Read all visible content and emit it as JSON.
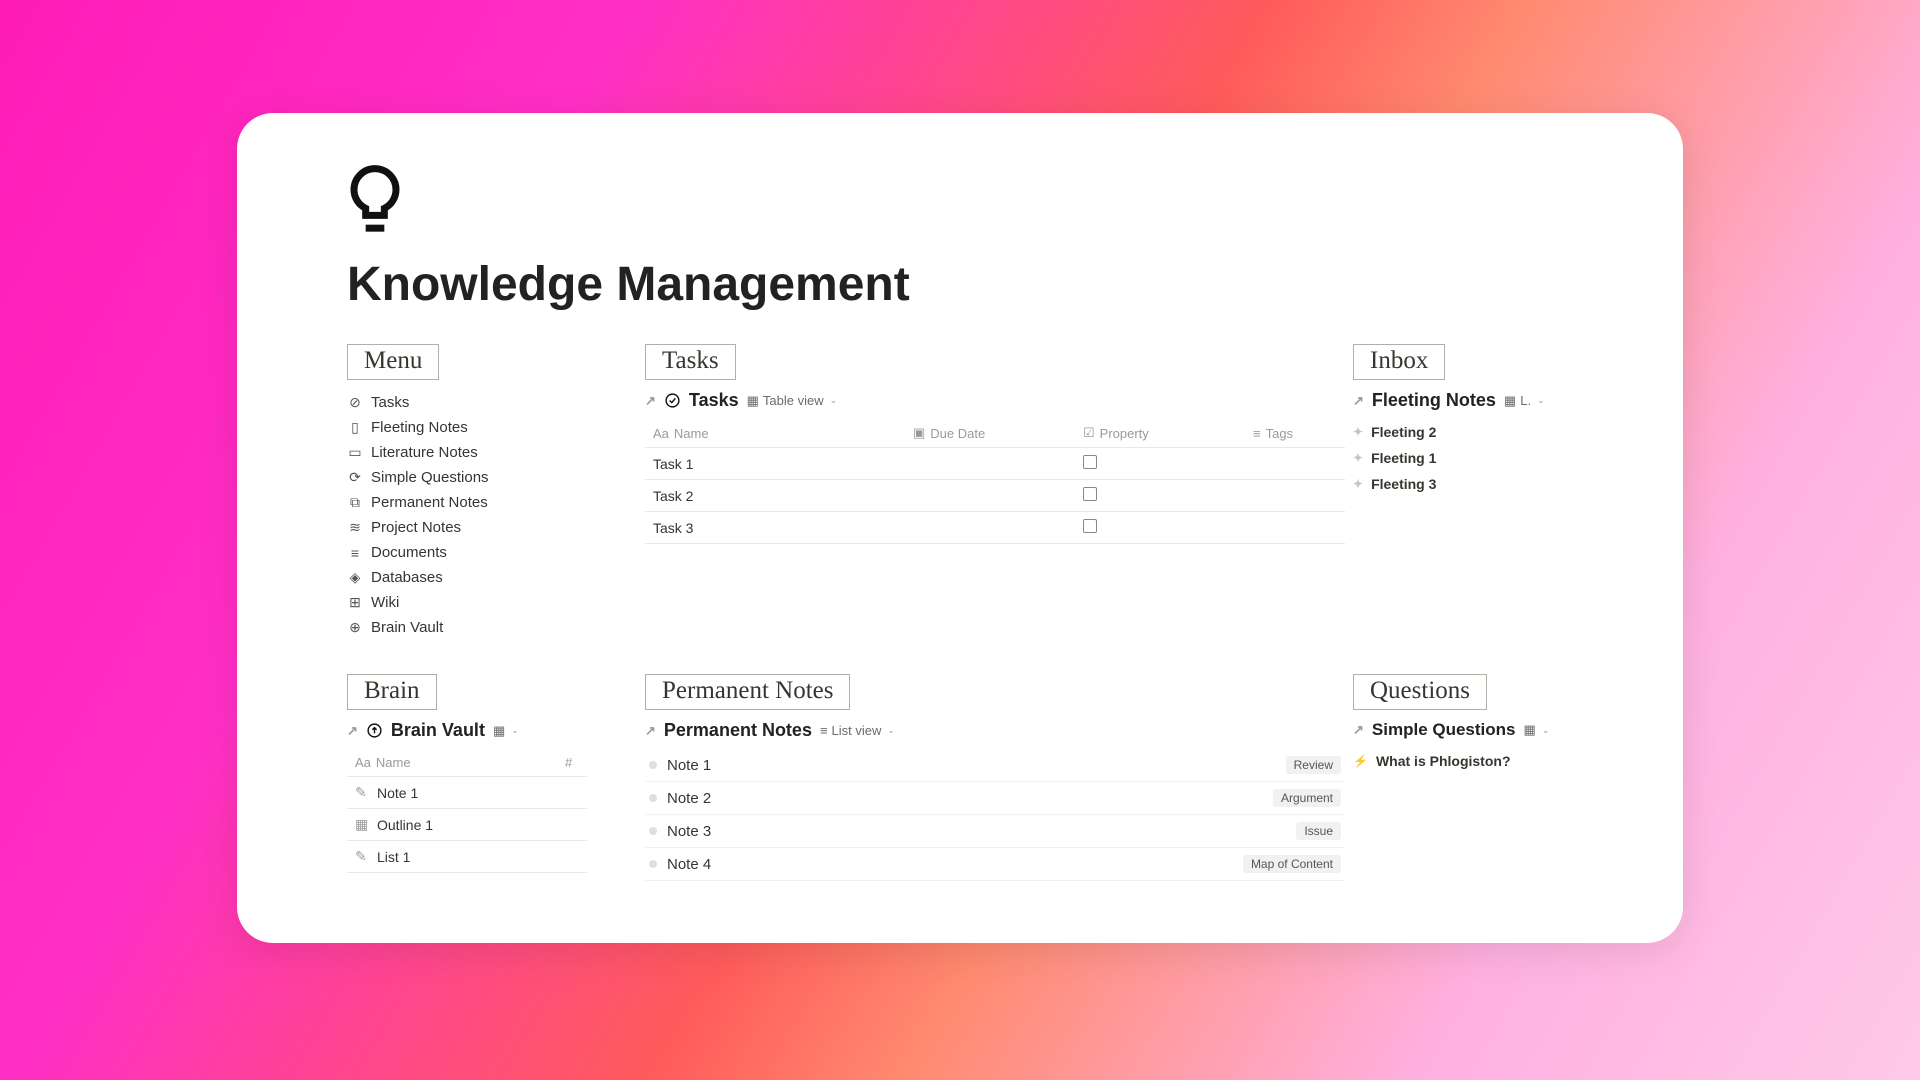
{
  "page": {
    "title": "Knowledge Management"
  },
  "menu": {
    "heading": "Menu",
    "items": [
      {
        "label": "Tasks",
        "icon": "check-circle"
      },
      {
        "label": "Fleeting Notes",
        "icon": "clipboard"
      },
      {
        "label": "Literature Notes",
        "icon": "book"
      },
      {
        "label": "Simple Questions",
        "icon": "refresh"
      },
      {
        "label": "Permanent Notes",
        "icon": "copy"
      },
      {
        "label": "Project Notes",
        "icon": "layers"
      },
      {
        "label": "Documents",
        "icon": "stack"
      },
      {
        "label": "Databases",
        "icon": "cube"
      },
      {
        "label": "Wiki",
        "icon": "grid"
      },
      {
        "label": "Brain Vault",
        "icon": "upload"
      }
    ]
  },
  "tasks": {
    "heading": "Tasks",
    "link_title": "Tasks",
    "view_label": "Table view",
    "columns": [
      "Name",
      "Due Date",
      "Property",
      "Tags"
    ],
    "rows": [
      {
        "name": "Task 1"
      },
      {
        "name": "Task 2"
      },
      {
        "name": "Task 3"
      }
    ]
  },
  "inbox": {
    "heading": "Inbox",
    "link_title": "Fleeting Notes",
    "view_label": "L.",
    "items": [
      "Fleeting 2",
      "Fleeting 1",
      "Fleeting 3"
    ]
  },
  "brain": {
    "heading": "Brain",
    "link_title": "Brain Vault",
    "columns": {
      "name": "Name"
    },
    "rows": [
      {
        "name": "Note 1",
        "icon": "note"
      },
      {
        "name": "Outline 1",
        "icon": "calendar"
      },
      {
        "name": "List 1",
        "icon": "note"
      }
    ]
  },
  "permanent": {
    "heading": "Permanent Notes",
    "link_title": "Permanent Notes",
    "view_label": "List view",
    "items": [
      {
        "name": "Note 1",
        "tag": "Review"
      },
      {
        "name": "Note 2",
        "tag": "Argument"
      },
      {
        "name": "Note 3",
        "tag": "Issue"
      },
      {
        "name": "Note 4",
        "tag": "Map of Content"
      }
    ]
  },
  "questions": {
    "heading": "Questions",
    "link_title": "Simple Questions",
    "items": [
      "What is Phlogiston?"
    ]
  }
}
